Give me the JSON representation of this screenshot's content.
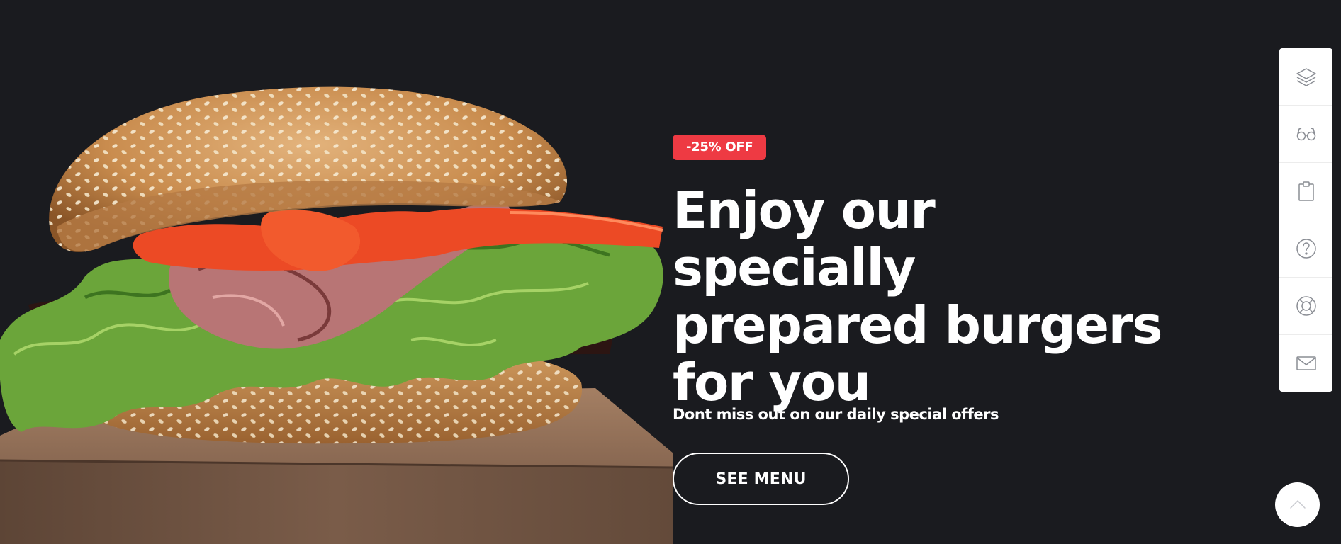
{
  "hero": {
    "badge": "-25% OFF",
    "headline": "Enjoy our specially prepared burgers for you",
    "subtitle": "Dont miss out on our daily special offers",
    "cta_label": "SEE MENU"
  },
  "toolbar": {
    "items": [
      {
        "icon": "layers-icon"
      },
      {
        "icon": "glasses-icon"
      },
      {
        "icon": "clipboard-icon"
      },
      {
        "icon": "help-icon"
      },
      {
        "icon": "lifebuoy-icon"
      },
      {
        "icon": "mail-icon"
      }
    ]
  },
  "scroll_top": {
    "icon": "chevron-up-icon"
  },
  "colors": {
    "background": "#1a1b1f",
    "badge": "#ee3a43",
    "text": "#ffffff",
    "toolbar": "#ffffff",
    "icon": "#8a8d94"
  }
}
